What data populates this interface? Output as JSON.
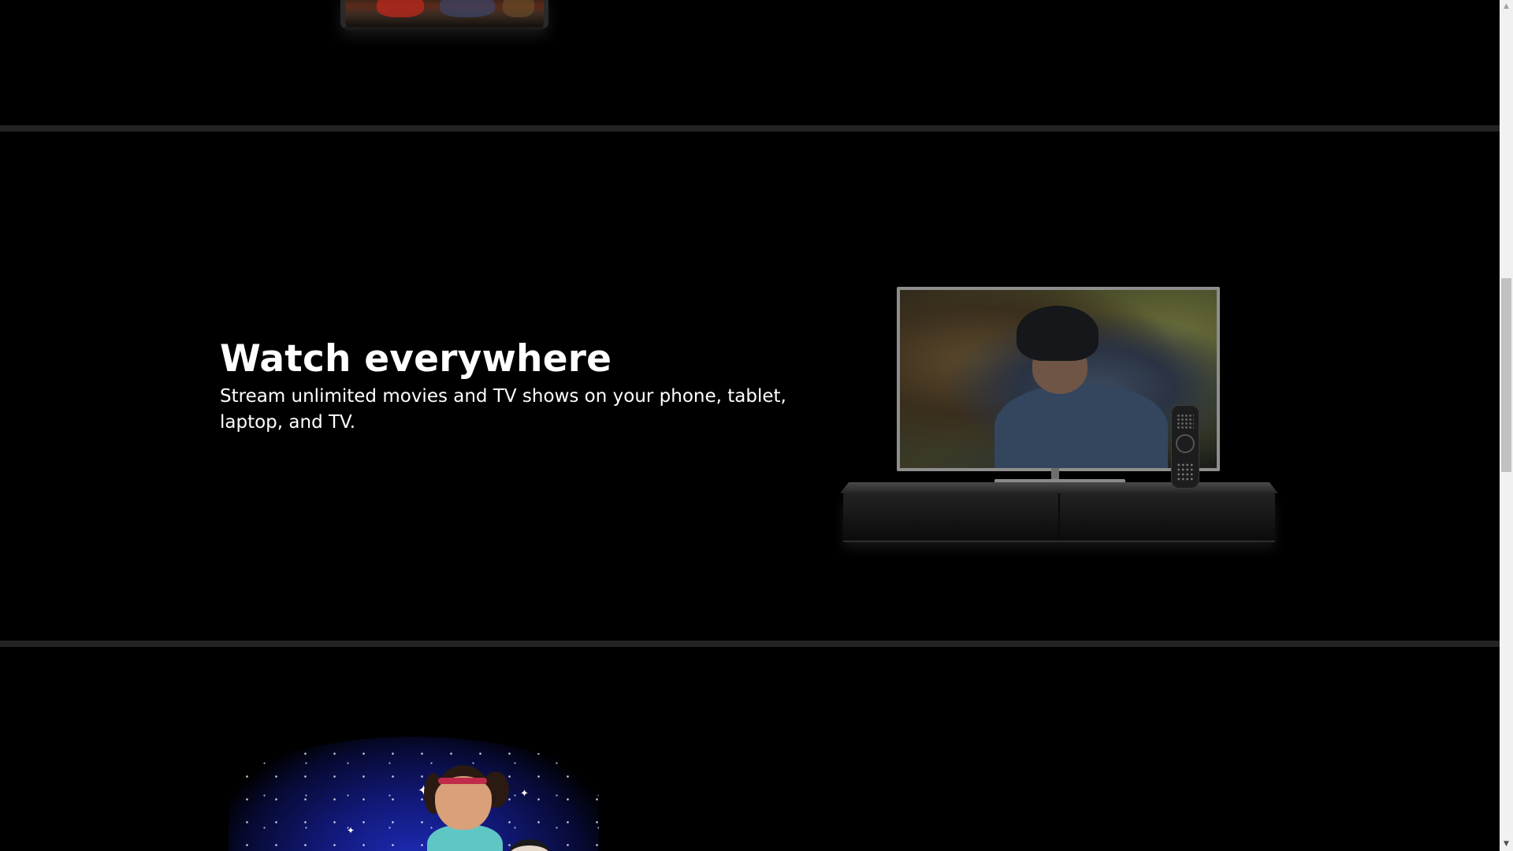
{
  "watch_section": {
    "heading": "Watch everywhere",
    "subheading": "Stream unlimited movies and TV shows on your phone, tablet, laptop, and TV."
  },
  "illustrations": {
    "top": "phone-image",
    "middle": "tv-image",
    "bottom": "kids-profile-image"
  },
  "scrollbar": {
    "up_arrow": "▲",
    "down_arrow": "▼",
    "scroll_position_fraction": 0.42
  },
  "colors": {
    "background": "#000000",
    "divider": "#232323",
    "text": "#ffffff"
  }
}
